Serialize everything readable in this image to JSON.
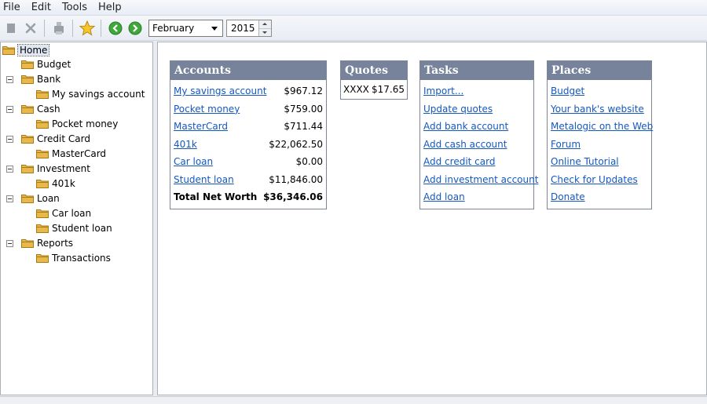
{
  "menu": {
    "items": [
      "File",
      "Edit",
      "Tools",
      "Help"
    ]
  },
  "toolbar": {
    "icons": [
      "stop-icon",
      "delete-icon",
      "print-icon",
      "favorite-star-icon",
      "back-arrow-icon",
      "forward-arrow-icon"
    ],
    "month": "February",
    "year": "2015"
  },
  "tree": {
    "home": "Home",
    "budget": "Budget",
    "bank": "Bank",
    "my_savings_account": "My savings account",
    "cash": "Cash",
    "pocket_money": "Pocket money",
    "credit_card": "Credit Card",
    "mastercard": "MasterCard",
    "investment": "Investment",
    "k401": "401k",
    "loan": "Loan",
    "car_loan": "Car loan",
    "student_loan": "Student loan",
    "reports": "Reports",
    "transactions": "Transactions"
  },
  "accounts": {
    "title": "Accounts",
    "rows": [
      {
        "name": "My savings account",
        "amount": "$967.12"
      },
      {
        "name": "Pocket money",
        "amount": "$759.00"
      },
      {
        "name": "MasterCard",
        "amount": "$711.44"
      },
      {
        "name": "401k",
        "amount": "$22,062.50"
      },
      {
        "name": "Car loan",
        "amount": "$0.00"
      },
      {
        "name": "Student loan",
        "amount": "$11,846.00"
      }
    ],
    "total_label": "Total Net Worth",
    "total_amount": "$36,346.06"
  },
  "quotes": {
    "title": "Quotes",
    "symbol": "XXXX",
    "price": "$17.65"
  },
  "tasks": {
    "title": "Tasks",
    "items": [
      "Import...",
      "Update quotes",
      "Add bank account",
      "Add cash account",
      "Add credit card",
      "Add investment account",
      "Add loan"
    ]
  },
  "places": {
    "title": "Places",
    "items": [
      "Budget",
      "Your bank's website",
      "Metalogic on the Web",
      "Forum",
      "Online Tutorial",
      "Check for Updates",
      "Donate"
    ]
  },
  "colors": {
    "box_header": "#77839b",
    "link": "#1458c0",
    "folder": "#e8b84a"
  }
}
